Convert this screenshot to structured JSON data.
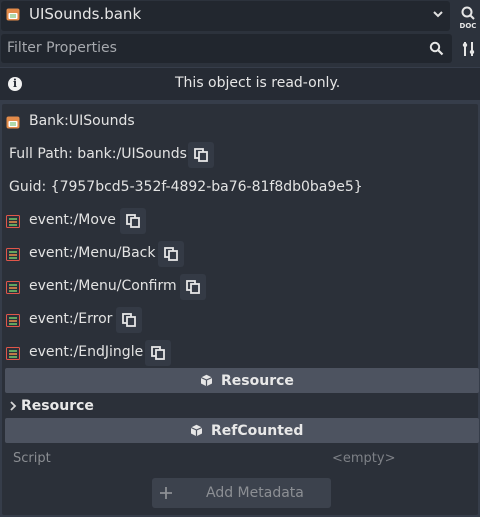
{
  "header": {
    "resource_name": "UISounds.bank"
  },
  "filter": {
    "placeholder": "Filter Properties"
  },
  "notice": {
    "text": "This object is read-only."
  },
  "bank": {
    "title": "Bank:UISounds",
    "full_path": "Full Path: bank:/UISounds",
    "guid": "Guid: {7957bcd5-352f-4892-ba76-81f8db0ba9e5}"
  },
  "events": [
    {
      "label": "event:/Move"
    },
    {
      "label": "event:/Menu/Back"
    },
    {
      "label": "event:/Menu/Confirm"
    },
    {
      "label": "event:/Error"
    },
    {
      "label": "event:/EndJingle"
    }
  ],
  "sections": {
    "resource_header": "Resource",
    "resource_group": "Resource",
    "refcounted_header": "RefCounted"
  },
  "script": {
    "label": "Script",
    "value": "<empty>"
  },
  "metadata": {
    "add_label": "Add Metadata"
  },
  "colors": {
    "background": "#363d4a",
    "panel": "#2b3039",
    "section_header": "#4d5360",
    "event_icon_green": "#6fc46a",
    "event_icon_red": "#e0564a",
    "bank_icon_orange": "#e38b4a"
  }
}
